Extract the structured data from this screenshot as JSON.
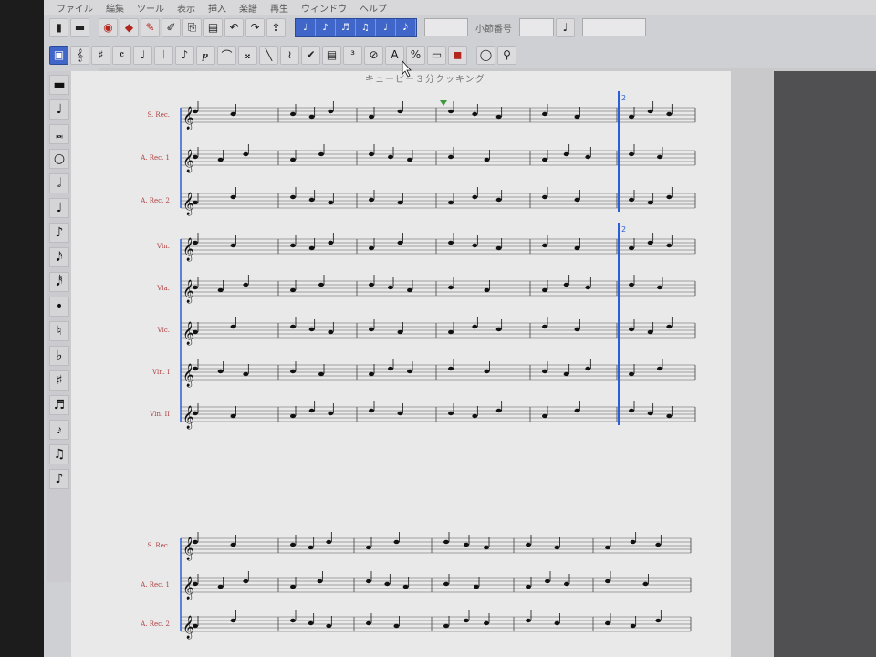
{
  "menu": [
    "ファイル",
    "編集",
    "ツール",
    "表示",
    "挿入",
    "楽譜",
    "再生",
    "ウィンドウ",
    "ヘルプ"
  ],
  "page_title": "キューピー３分クッキング",
  "toolbar_label": "小節番号",
  "instruments_system1": [
    "S. Rec.",
    "A. Rec. 1",
    "A. Rec. 2"
  ],
  "instruments_system2": [
    "Vln.",
    "Vla.",
    "Vlc.",
    "Vln. I",
    "Vln. II"
  ],
  "instruments_system3": [
    "S. Rec.",
    "A. Rec. 1",
    "A. Rec. 2"
  ],
  "rehearsal_mark": "2",
  "icons": {
    "toolbar1": [
      "save-icon",
      "print-icon",
      "paint-icon",
      "library-icon",
      "brush-icon",
      "pen-icon",
      "copy-icon",
      "paste-icon",
      "undo-icon",
      "redo-icon",
      "export-icon"
    ],
    "palette": [
      "rest-icon",
      "close-icon",
      "note-icon",
      "minus-icon",
      "breve-icon",
      "minus-icon",
      "whole-note-icon",
      "sharp-icon",
      "half-note-icon",
      "quarter-rest-icon",
      "quarter-note-icon",
      "eighth-rest-icon",
      "eighth-note-icon",
      "sixteenth-rest-icon",
      "sixteenth-note-icon",
      "thirtysecond-rest-icon",
      "sixtyfourth-note-icon",
      "dot-icon",
      "natural-icon",
      "flat-icon",
      "sharp-acc-icon",
      "tuplet-icon",
      "grace-note-icon",
      "beam-icon",
      "flag-icon"
    ]
  },
  "colors": {
    "accent": "#3f66c8",
    "cursor": "#2a5fd8",
    "marker": "#3c9a3c"
  }
}
